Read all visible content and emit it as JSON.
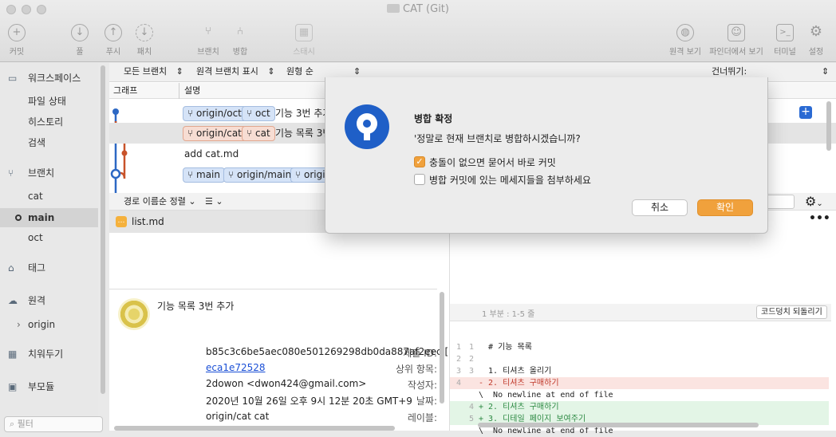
{
  "window": {
    "title": "CAT (Git)"
  },
  "toolbar": {
    "commit": "커밋",
    "pull": "풀",
    "push": "푸시",
    "fetch": "패치",
    "branch": "브랜치",
    "merge": "병합",
    "stash": "스태시",
    "remote_view": "원격 보기",
    "finder_view": "파인더에서 보기",
    "terminal": "터미널",
    "settings": "설정"
  },
  "sidebar": {
    "workspace": "워크스페이스",
    "file_status": "파일 상태",
    "history": "히스토리",
    "search": "검색",
    "branches": "브랜치",
    "branch_items": [
      "cat",
      "main",
      "oct"
    ],
    "current_branch": "main",
    "tags": "태그",
    "remotes": "원격",
    "remote_items": [
      "origin"
    ],
    "stashes": "치워두기",
    "submodules": "부모듈",
    "filter_placeholder": "필터"
  },
  "filterbar": {
    "branches": "모든 브랜치",
    "remote": "원격 브랜치 표시",
    "order": "원형 순",
    "skip": "건너뛰기:"
  },
  "columns": {
    "graph": "그래프",
    "desc": "설명"
  },
  "commits": [
    {
      "tags": [
        "origin/oct",
        "oct"
      ],
      "tag_color": "blue",
      "message": "기능 3번 추가"
    },
    {
      "tags": [
        "origin/cat",
        "cat"
      ],
      "tag_color": "orange",
      "message": "기능 목록 3번"
    },
    {
      "tags": [],
      "tag_color": "none",
      "message": "add cat.md"
    },
    {
      "tags": [
        "main",
        "origin/main",
        "origi"
      ],
      "tag_color": "blue",
      "message": ""
    }
  ],
  "files": {
    "sort": "경로 이름순 정렬",
    "list_mode": "☰",
    "items": [
      "list.md"
    ]
  },
  "commit_detail": {
    "title": "기능 목록 3번 추가",
    "labels": {
      "id": "제출 ID:",
      "parent": "상위 항목:",
      "author": "작성자:",
      "date": "날짜:",
      "label": "레이블:"
    },
    "id": "b85c3c6be5aec080e501269298db0da887af2eec [",
    "parent": "eca1e72528",
    "author": "2dowon <dwon424@gmail.com>",
    "date": "2020년 10월 26일 오후 9시 12분 20초 GMT+9",
    "label": "origin/cat cat"
  },
  "diff": {
    "hunk": "1 부분 : 1-5 줄",
    "revert": "코드덩치 되돌리기",
    "lines": [
      {
        "a": "1",
        "b": "1",
        "type": "ctx",
        "text": "  # 기능 목록"
      },
      {
        "a": "2",
        "b": "2",
        "type": "ctx",
        "text": ""
      },
      {
        "a": "3",
        "b": "3",
        "type": "ctx",
        "text": "  1. 티셔츠 올리기"
      },
      {
        "a": "4",
        "b": "",
        "type": "del",
        "text": "- 2. 티셔츠 구매하기"
      },
      {
        "a": "",
        "b": "",
        "type": "ctx",
        "text": "\\  No newline at end of file"
      },
      {
        "a": "",
        "b": "4",
        "type": "add",
        "text": "+ 2. 티셔츠 구매하기"
      },
      {
        "a": "",
        "b": "5",
        "type": "add",
        "text": "+ 3. 디테일 페이지 보여주기"
      },
      {
        "a": "",
        "b": "",
        "type": "ctx",
        "text": "\\  No newline at end of file"
      }
    ]
  },
  "dialog": {
    "title": "병합 확정",
    "message": "'정말로 현재 브랜치로 병합하시겠습니까?",
    "option1": "충돌이 없으면 묻어서 바로 커밋",
    "option1_checked": true,
    "option2": "병합 커밋에 있는 메세지들을 첨부하세요",
    "option2_checked": false,
    "cancel": "취소",
    "ok": "확인"
  },
  "colors": {
    "accent": "#f0a13c",
    "blue": "#1f5fc7",
    "graph_orange": "#c8532a"
  }
}
